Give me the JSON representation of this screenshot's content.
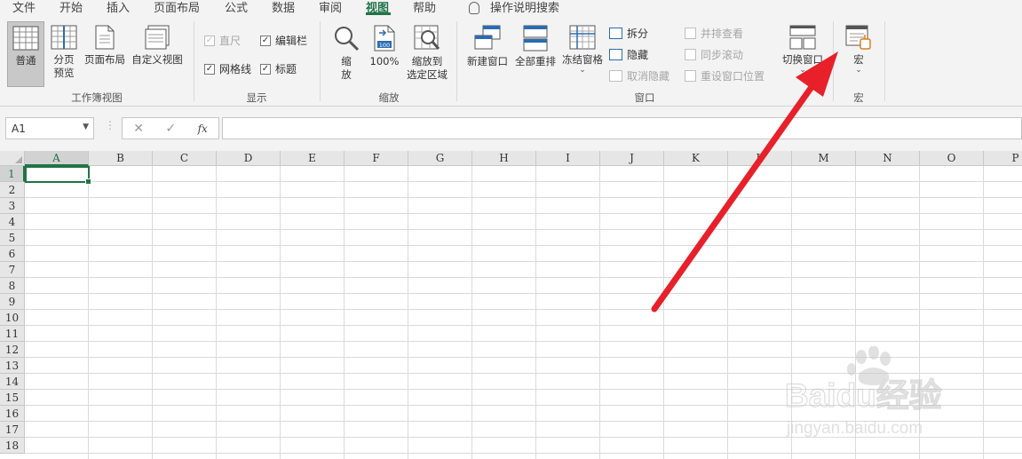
{
  "menu": {
    "tabs": [
      "文件",
      "开始",
      "插入",
      "页面布局",
      "公式",
      "数据",
      "审阅",
      "视图",
      "帮助"
    ],
    "active_tab": "视图",
    "tell_me": "操作说明搜索"
  },
  "ribbon": {
    "workbook_views": {
      "label": "工作簿视图",
      "normal": "普通",
      "page_break_line1": "分页",
      "page_break_line2": "预览",
      "page_layout": "页面布局",
      "custom_views": "自定义视图"
    },
    "show": {
      "label": "显示",
      "ruler": "直尺",
      "formula_bar": "编辑栏",
      "gridlines": "网格线",
      "headings": "标题"
    },
    "zoom": {
      "label": "缩放",
      "zoom_line1": "缩",
      "zoom_line2": "放",
      "hundred": "100%",
      "to_selection_line1": "缩放到",
      "to_selection_line2": "选定区域",
      "icon_text": "100"
    },
    "window": {
      "label": "窗口",
      "new_window": "新建窗口",
      "arrange_all": "全部重排",
      "freeze_panes": "冻结窗格",
      "split": "拆分",
      "hide": "隐藏",
      "unhide": "取消隐藏",
      "side_by_side": "并排查看",
      "sync_scroll": "同步滚动",
      "reset_position": "重设窗口位置",
      "switch_windows": "切换窗口"
    },
    "macros": {
      "label": "宏",
      "macros": "宏"
    }
  },
  "formula_bar": {
    "name_box": "A1",
    "cancel": "✕",
    "enter": "✓",
    "fx": "fx",
    "value": ""
  },
  "sheet": {
    "columns": [
      "A",
      "B",
      "C",
      "D",
      "E",
      "F",
      "G",
      "H",
      "I",
      "J",
      "K",
      "L",
      "M",
      "N",
      "O",
      "P"
    ],
    "rows": [
      "1",
      "2",
      "3",
      "4",
      "5",
      "6",
      "7",
      "8",
      "9",
      "10",
      "11",
      "12",
      "13",
      "14",
      "15",
      "16",
      "17",
      "18"
    ],
    "active_cell": "A1"
  },
  "watermark": {
    "brand": "Baidu经验",
    "url": "jingyan.baidu.com"
  },
  "colors": {
    "accent": "#217346",
    "arrow": "#e8202a"
  }
}
